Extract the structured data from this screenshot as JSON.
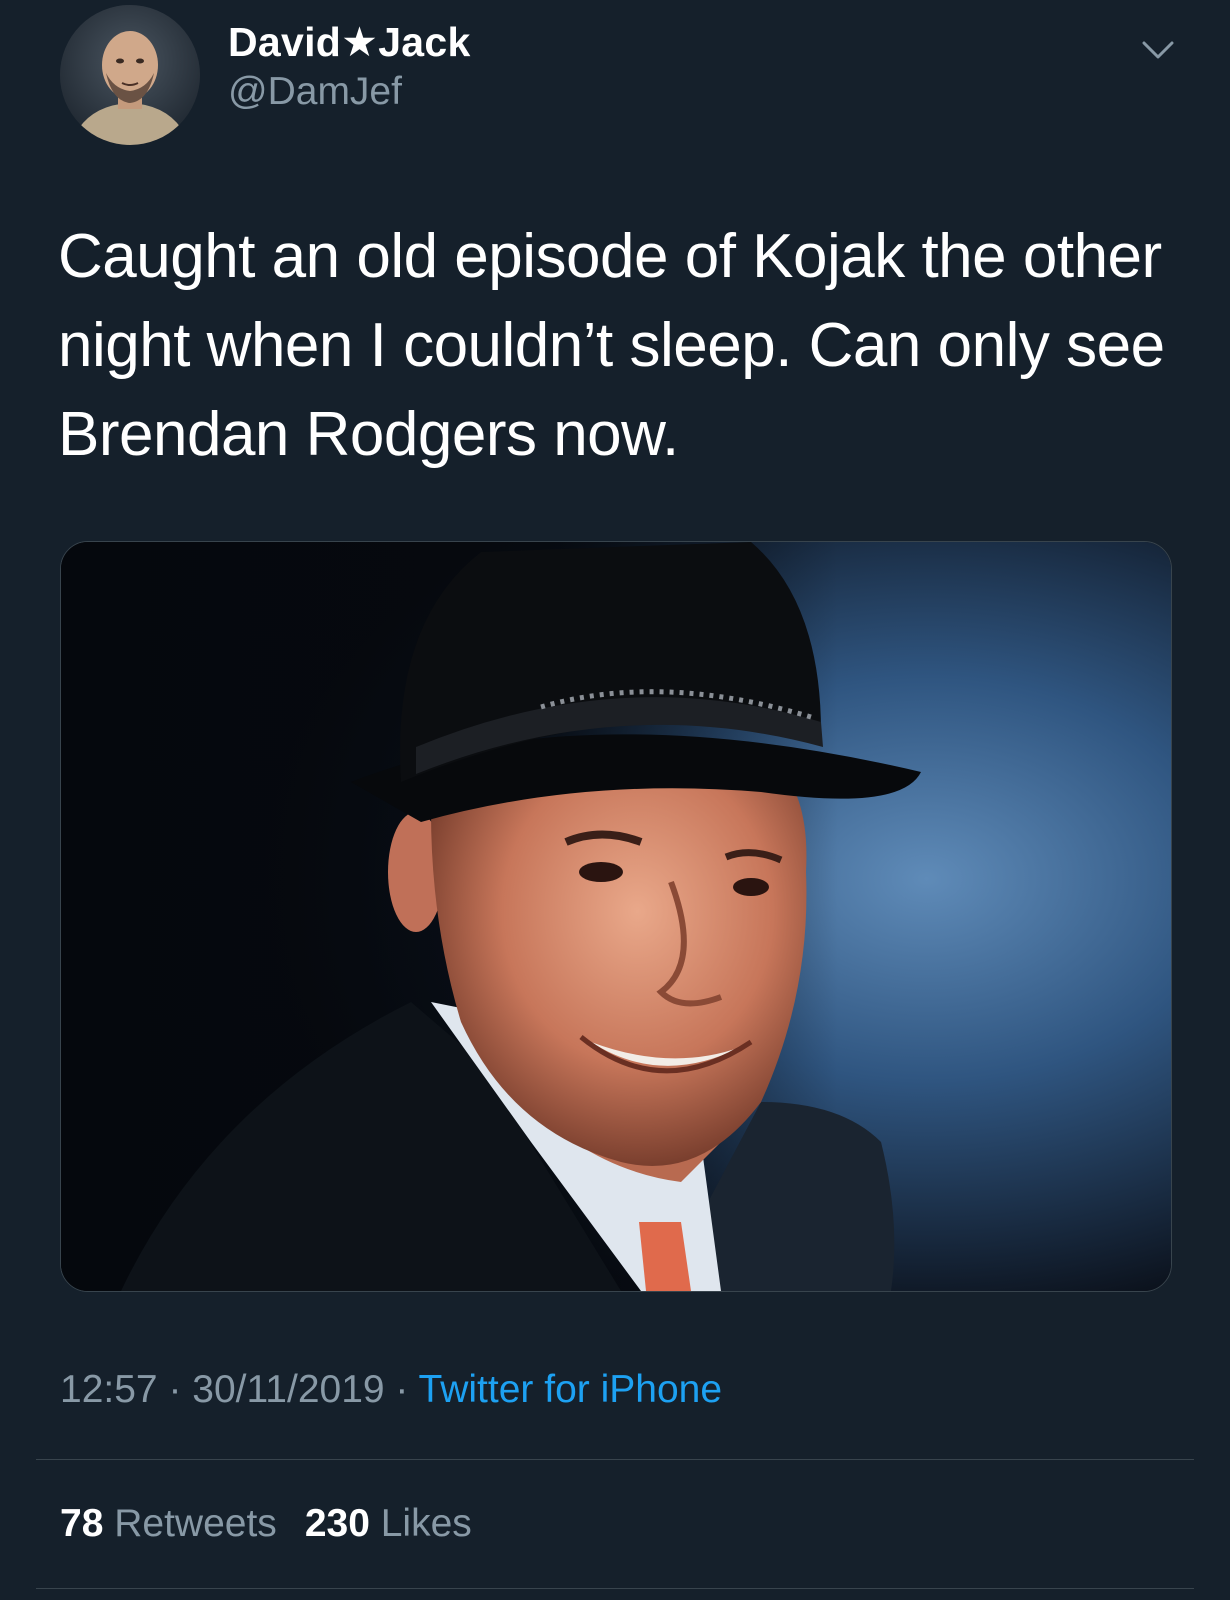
{
  "tweet": {
    "author": {
      "display_name": "David★Jack",
      "handle": "@DamJef"
    },
    "text": "Caught an old episode of Kojak the other night when I couldn’t sleep. Can only see Brendan Rodgers now.",
    "meta": {
      "time": "12:57",
      "separator": " · ",
      "date": "30/11/2019",
      "source": "Twitter for iPhone"
    },
    "stats": {
      "retweets_count": "78",
      "retweets_label": "Retweets",
      "likes_count": "230",
      "likes_label": "Likes"
    }
  },
  "icons": {
    "menu": "chevron-down-icon",
    "avatar": "profile-photo",
    "media": "photo-man-in-fedora"
  },
  "colors": {
    "background": "#15202b",
    "primary_text": "#ffffff",
    "secondary_text": "#8899a6",
    "link": "#1da1f2",
    "divider": "#38444d"
  }
}
